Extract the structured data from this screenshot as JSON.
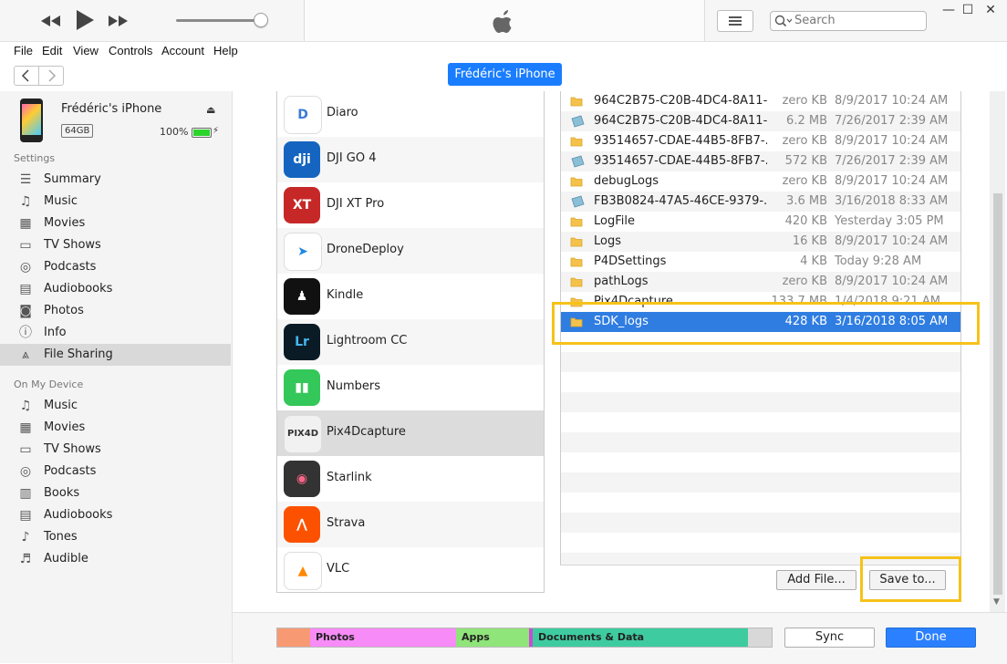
{
  "window": {
    "min": "—",
    "max": "☐",
    "close": "✕"
  },
  "search": {
    "placeholder": "Search"
  },
  "menu": [
    "File",
    "Edit",
    "View",
    "Controls",
    "Account",
    "Help"
  ],
  "device_button": "Frédéric's iPhone",
  "device": {
    "name": "Frédéric's iPhone",
    "capacity": "64GB",
    "battery": "100%"
  },
  "sidebar": {
    "settings_heading": "Settings",
    "settings": [
      "Summary",
      "Music",
      "Movies",
      "TV Shows",
      "Podcasts",
      "Audiobooks",
      "Photos",
      "Info",
      "File Sharing"
    ],
    "device_heading": "On My Device",
    "on_device": [
      "Music",
      "Movies",
      "TV Shows",
      "Podcasts",
      "Books",
      "Audiobooks",
      "Tones",
      "Audible"
    ]
  },
  "apps": [
    "Diaro",
    "DJI GO 4",
    "DJI XT Pro",
    "DroneDeploy",
    "Kindle",
    "Lightroom CC",
    "Numbers",
    "Pix4Dcapture",
    "Starlink",
    "Strava",
    "VLC"
  ],
  "app_icons": [
    {
      "glyph": "D",
      "bg": "#ffffff",
      "fg": "#3a7bd5"
    },
    {
      "glyph": "dji",
      "bg": "#1565c0",
      "fg": "#ffffff"
    },
    {
      "glyph": "XT",
      "bg": "#c62828",
      "fg": "#ffffff"
    },
    {
      "glyph": "➤",
      "bg": "#ffffff",
      "fg": "#1e88e5"
    },
    {
      "glyph": "♟",
      "bg": "#111111",
      "fg": "#ffffff"
    },
    {
      "glyph": "Lr",
      "bg": "#0b1b26",
      "fg": "#43b6f0"
    },
    {
      "glyph": "▮▮",
      "bg": "#34c759",
      "fg": "#ffffff"
    },
    {
      "glyph": "PIX4D",
      "bg": "#f1f1f1",
      "fg": "#333333"
    },
    {
      "glyph": "◉",
      "bg": "#333333",
      "fg": "#ff6688"
    },
    {
      "glyph": "⋀",
      "bg": "#fc5200",
      "fg": "#ffffff"
    },
    {
      "glyph": "▲",
      "bg": "#ffffff",
      "fg": "#ff8800"
    }
  ],
  "files": [
    {
      "name": "964C2B75-C20B-4DC4-8A11-...",
      "size": "zero KB",
      "date": "8/9/2017 10:24 AM",
      "type": "folder"
    },
    {
      "name": "964C2B75-C20B-4DC4-8A11-...",
      "size": "6.2 MB",
      "date": "7/26/2017 2:39 AM",
      "type": "file"
    },
    {
      "name": "93514657-CDAE-44B5-8FB7-...",
      "size": "zero KB",
      "date": "8/9/2017 10:24 AM",
      "type": "folder"
    },
    {
      "name": "93514657-CDAE-44B5-8FB7-...",
      "size": "572 KB",
      "date": "7/26/2017 2:39 AM",
      "type": "file"
    },
    {
      "name": "debugLogs",
      "size": "zero KB",
      "date": "8/9/2017 10:24 AM",
      "type": "folder"
    },
    {
      "name": "FB3B0824-47A5-46CE-9379-...",
      "size": "3.6 MB",
      "date": "3/16/2018 8:33 AM",
      "type": "file"
    },
    {
      "name": "LogFile",
      "size": "420 KB",
      "date": "Yesterday 3:05 PM",
      "type": "folder"
    },
    {
      "name": "Logs",
      "size": "16 KB",
      "date": "8/9/2017 10:24 AM",
      "type": "folder"
    },
    {
      "name": "P4DSettings",
      "size": "4 KB",
      "date": "Today 9:28 AM",
      "type": "folder"
    },
    {
      "name": "pathLogs",
      "size": "zero KB",
      "date": "8/9/2017 10:24 AM",
      "type": "folder"
    },
    {
      "name": "Pix4Dcapture",
      "size": "133.7 MB",
      "date": "1/4/2018 9:21 AM",
      "type": "folder"
    },
    {
      "name": "SDK_logs",
      "size": "428 KB",
      "date": "3/16/2018 8:05 AM",
      "type": "folder"
    }
  ],
  "buttons": {
    "add_file": "Add File...",
    "save_to": "Save to...",
    "sync": "Sync",
    "done": "Done"
  },
  "storage": [
    {
      "label": "",
      "color": "#f79a74"
    },
    {
      "label": "Photos",
      "color": "#f78bf7"
    },
    {
      "label": "Apps",
      "color": "#8fe47a"
    },
    {
      "label": "",
      "color": "#c84cd6"
    },
    {
      "label": "Documents & Data",
      "color": "#3ecba0"
    },
    {
      "label": "",
      "color": "#d8d8d8"
    }
  ],
  "colors": {
    "accent": "#1a7dff",
    "highlight": "#f6c21a",
    "selection": "#2f7de1"
  }
}
